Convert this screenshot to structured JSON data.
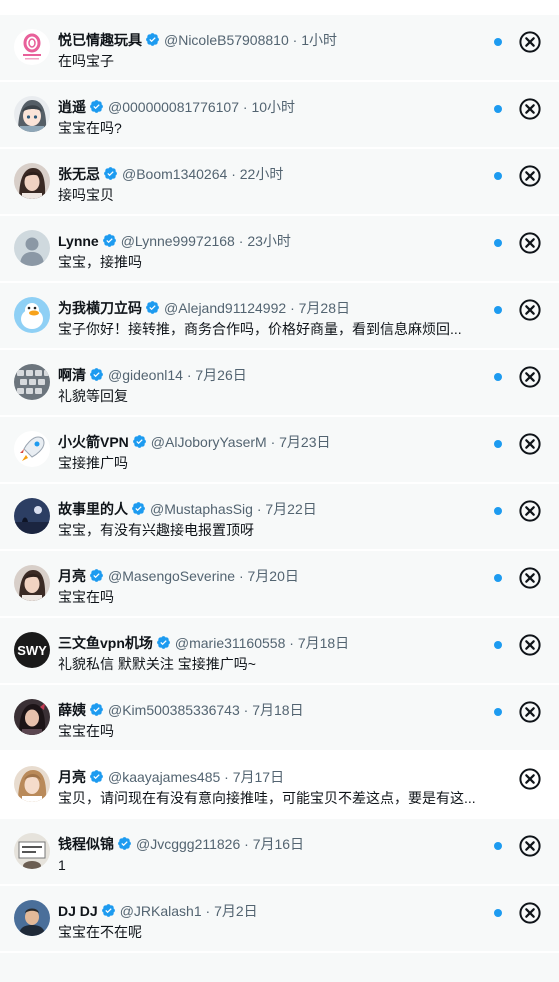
{
  "colors": {
    "accent": "#1d9bf0",
    "unread_bg": "#f7f9f9",
    "read_bg": "#ffffff",
    "secondary_text": "#536471"
  },
  "separator": "·",
  "conversations": [
    {
      "name": "悦已情趣玩具",
      "verified": true,
      "handle": "@NicoleB57908810",
      "time": "1小时",
      "message": "在吗宝子",
      "unread": true,
      "avatar": "pink-logo"
    },
    {
      "name": "逍遥",
      "verified": true,
      "handle": "@000000081776107",
      "time": "10小时",
      "message": "宝宝在吗?",
      "unread": true,
      "avatar": "anime-girl"
    },
    {
      "name": "张无忌",
      "verified": true,
      "handle": "@Boom1340264",
      "time": "22小时",
      "message": "接吗宝贝",
      "unread": true,
      "avatar": "woman-photo"
    },
    {
      "name": "Lynne",
      "verified": true,
      "handle": "@Lynne99972168",
      "time": "23小时",
      "message": "宝宝，接推吗",
      "unread": true,
      "avatar": "default-person"
    },
    {
      "name": "为我横刀立码",
      "verified": true,
      "handle": "@Alejand91124992",
      "time": "7月28日",
      "message": "宝子你好！接转推，商务合作吗，价格好商量，看到信息麻烦回...",
      "unread": true,
      "avatar": "cartoon-duck"
    },
    {
      "name": "啊清",
      "verified": true,
      "handle": "@gideonl14",
      "time": "7月26日",
      "message": "礼貌等回复",
      "unread": true,
      "avatar": "keyboard-photo"
    },
    {
      "name": "小火箭VPN",
      "verified": true,
      "handle": "@AlJoboryYaserM",
      "time": "7月23日",
      "message": "宝接推广吗",
      "unread": true,
      "avatar": "rocket-logo"
    },
    {
      "name": "故事里的人",
      "verified": true,
      "handle": "@MustaphasSig",
      "time": "7月22日",
      "message": "宝宝，有没有兴趣接电报置顶呀",
      "unread": true,
      "avatar": "night-photo"
    },
    {
      "name": "月亮",
      "verified": true,
      "handle": "@MasengoSeverine",
      "time": "7月20日",
      "message": "宝宝在吗",
      "unread": true,
      "avatar": "woman-photo"
    },
    {
      "name": "三文鱼vpn机场",
      "verified": true,
      "handle": "@marie31160558",
      "time": "7月18日",
      "message": "礼貌私信 默默关注 宝接推广吗~",
      "unread": true,
      "avatar": "swy-logo",
      "avatar_text": "SWY"
    },
    {
      "name": "薛姨",
      "verified": true,
      "handle": "@Kim500385336743",
      "time": "7月18日",
      "message": "宝宝在吗",
      "unread": true,
      "avatar": "woman-dark-photo"
    },
    {
      "name": "月亮",
      "verified": true,
      "handle": "@kaayajames485",
      "time": "7月17日",
      "message": "宝贝，请问现在有没有意向接推哇，可能宝贝不差这点，要是有这...",
      "unread": false,
      "avatar": "woman-blonde-photo"
    },
    {
      "name": "钱程似锦",
      "verified": true,
      "handle": "@Jvcggg211826",
      "time": "7月16日",
      "message": "1",
      "unread": true,
      "avatar": "sign-photo"
    },
    {
      "name": "DJ DJ",
      "verified": true,
      "handle": "@JRKalash1",
      "time": "7月2日",
      "message": "宝宝在不在呢",
      "unread": true,
      "avatar": "man-photo"
    }
  ]
}
